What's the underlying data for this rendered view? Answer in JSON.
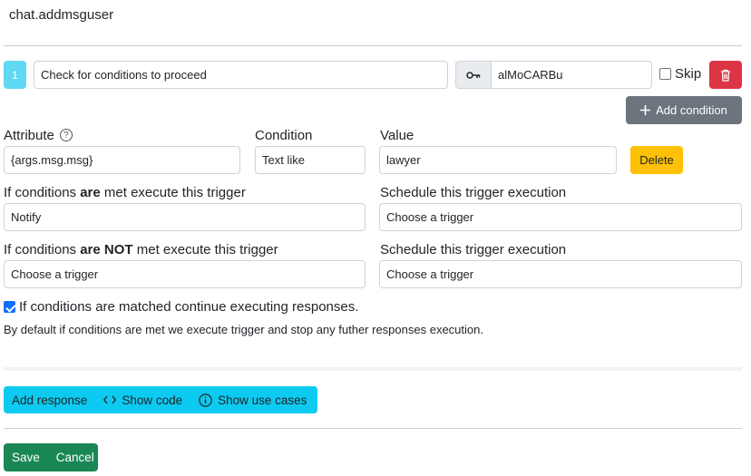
{
  "page": {
    "title": "chat.addmsguser"
  },
  "step": {
    "number": "1",
    "description": "Check for conditions to proceed",
    "identifier": "alMoCARBu",
    "skip_label": "Skip",
    "skip_checked": false
  },
  "buttons": {
    "add_condition": "Add condition",
    "delete": "Delete",
    "add_response": "Add response",
    "show_code": "Show code",
    "show_use_cases": "Show use cases",
    "save": "Save",
    "cancel": "Cancel"
  },
  "condition": {
    "attribute_label": "Attribute",
    "condition_label": "Condition",
    "value_label": "Value",
    "attribute": "{args.msg.msg}",
    "operator": "Text like",
    "value": "lawyer"
  },
  "triggers": {
    "met_label_pre": "If conditions ",
    "met_label_bold": "are",
    "met_label_post": " met execute this trigger",
    "met_value": "Notify",
    "schedule_label": "Schedule this trigger execution",
    "schedule_met_value": "Choose a trigger",
    "not_met_label_pre": "If conditions ",
    "not_met_label_bold": "are NOT",
    "not_met_label_post": " met execute this trigger",
    "not_met_value": "Choose a trigger",
    "schedule_not_met_value": "Choose a trigger"
  },
  "continue": {
    "label": "If conditions are matched continue executing responses.",
    "checked": true,
    "help": "By default if conditions are met we execute trigger and stop any futher responses execution."
  },
  "colors": {
    "badge": "#5ed8f3",
    "danger": "#dc3545",
    "secondary": "#6c757d",
    "warning": "#ffc107",
    "info": "#0dcaf0",
    "success": "#198754",
    "primary": "#0d6efd"
  },
  "icons": {
    "key": "key-icon",
    "trash": "trash-icon",
    "plus": "plus-icon",
    "help": "question-circle-icon",
    "code": "code-icon",
    "info": "info-circle-icon"
  }
}
